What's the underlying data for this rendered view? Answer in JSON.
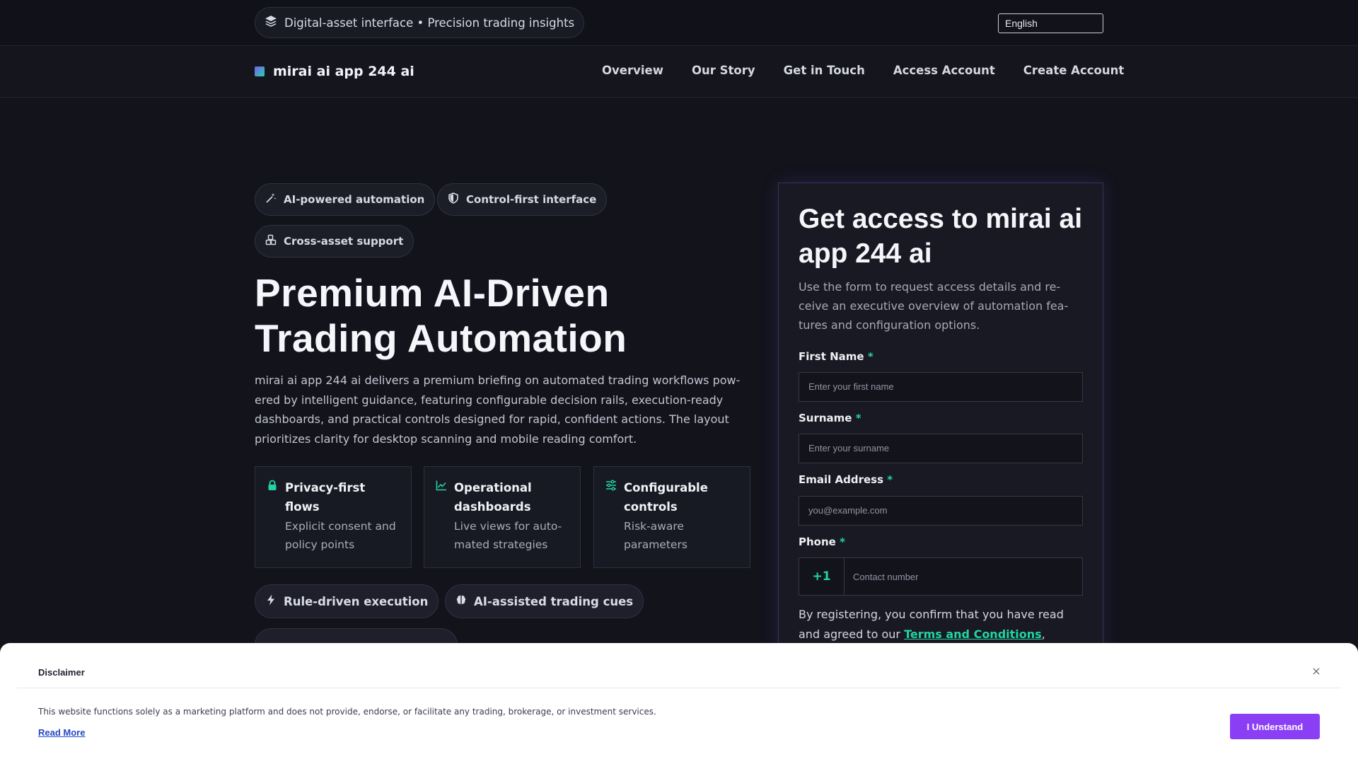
{
  "topbar": {
    "tagline": "Digital-asset interface • Precision trading insights",
    "tagline_icon": "layers-icon",
    "language": "English"
  },
  "nav": {
    "brand": "mirai ai app 244 ai",
    "links": [
      "Overview",
      "Our Story",
      "Get in Touch",
      "Access Account",
      "Create Account"
    ]
  },
  "hero": {
    "chips": [
      {
        "label": "AI-powered automation",
        "icon": "magic-wand-icon"
      },
      {
        "label": "Control-first interface",
        "icon": "shield-icon"
      },
      {
        "label": "Cross-asset support",
        "icon": "cubes-icon"
      }
    ],
    "title": "Premium AI-Driven Trading Automation",
    "description": "mirai ai app 244 ai delivers a premium briefing on automated trading workflows pow-ered by intelligent guidance, featuring configurable decision rails, execution-ready dashboards, and practical controls designed for rapid, confident actions. The layout prioritizes clarity for desktop scanning and mobile reading comfort.",
    "features": [
      {
        "title": "Privacy-first flows",
        "desc": "Explicit consent and policy points",
        "icon": "lock-icon"
      },
      {
        "title": "Operational dashboards",
        "desc": "Live views for auto-mated strategies",
        "icon": "chart-line-icon"
      },
      {
        "title": "Configurable controls",
        "desc": "Risk-aware parameters",
        "icon": "sliders-icon"
      }
    ],
    "pills": [
      {
        "label": "Rule-driven execution",
        "icon": "bolt-icon"
      },
      {
        "label": "AI-assisted trading cues",
        "icon": "brain-icon"
      }
    ]
  },
  "form": {
    "title": "Get access to mirai ai app 244 ai",
    "subtitle": "Use the form to request access details and re-ceive an executive overview of automation fea-tures and configuration options.",
    "first_name_label": "First Name",
    "first_name_placeholder": "Enter your first name",
    "surname_label": "Surname",
    "surname_placeholder": "Enter your surname",
    "email_label": "Email Address",
    "email_placeholder": "you@example.com",
    "phone_label": "Phone",
    "phone_code": "+1",
    "phone_placeholder": "Contact number",
    "required_mark": "*",
    "consent_text": "By registering, you confirm that you have read and agreed to our",
    "terms_link": "Terms and Conditions",
    "consent_trail": ","
  },
  "disclaimer": {
    "title": "Disclaimer",
    "text": "This website functions solely as a marketing platform and does not provide, endorse, or facilitate any trading, brokerage, or investment services.",
    "read_more": "Read More",
    "button": "I Understand",
    "close": "×"
  },
  "colors": {
    "accent_green": "#22d3a6",
    "accent_purple": "#8b3ff5",
    "background": "#12131b"
  }
}
